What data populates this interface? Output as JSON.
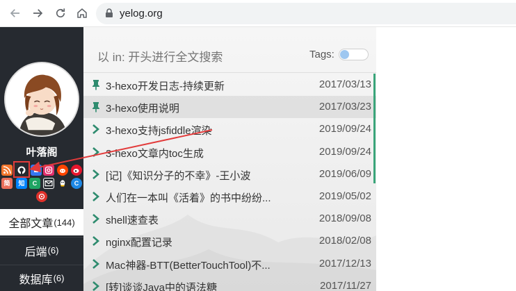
{
  "browser": {
    "url": "yelog.org"
  },
  "sidebar": {
    "site_name": "叶落阁",
    "social_icons": [
      {
        "name": "rss-icon",
        "color": "#f2762c",
        "glyph": "rss"
      },
      {
        "name": "github-icon",
        "color": "#262a30",
        "glyph": "github"
      },
      {
        "name": "blue-square-icon",
        "color": "#3577f0",
        "glyph": "square"
      },
      {
        "name": "instagram-icon",
        "color": "#e1306c",
        "glyph": "instagram"
      },
      {
        "name": "reddit-icon",
        "color": "#ff4500",
        "glyph": "reddit"
      },
      {
        "name": "weibo-icon",
        "color": "#e6162d",
        "glyph": "weibo"
      },
      {
        "name": "jianshu-icon",
        "color": "#ea6f5a",
        "glyph": "简"
      },
      {
        "name": "zhihu-icon",
        "color": "#0084ff",
        "glyph": "知"
      },
      {
        "name": "csdn-icon",
        "color": "#1fa463",
        "glyph": "C"
      },
      {
        "name": "mail-icon",
        "color": "#262a30",
        "glyph": "mail"
      },
      {
        "name": "qq-icon",
        "color": "#262a30",
        "glyph": "qq"
      },
      {
        "name": "csdn-alt-icon",
        "color": "#1e88e5",
        "glyph": "C"
      },
      {
        "name": "neteasemusic-icon",
        "color": "#e0312b",
        "glyph": "music"
      }
    ],
    "categories": [
      {
        "label": "全部文章",
        "count": "(144)",
        "active": true
      },
      {
        "label": "后端",
        "count": "(6)",
        "active": false
      },
      {
        "label": "数据库",
        "count": "(6)",
        "active": false
      }
    ]
  },
  "search": {
    "placeholder": "以 in: 开头进行全文搜索",
    "tags_label": "Tags:"
  },
  "posts": [
    {
      "title": "3-hexo开发日志-持续更新",
      "date": "2017/03/13",
      "pinned": true
    },
    {
      "title": "3-hexo使用说明",
      "date": "2017/03/23",
      "pinned": true
    },
    {
      "title": "3-hexo支持jsfiddle渲染",
      "date": "2019/09/24",
      "pinned": false
    },
    {
      "title": "3-hexo文章内toc生成",
      "date": "2019/09/24",
      "pinned": false
    },
    {
      "title": "[记]《知识分子的不幸》-王小波",
      "date": "2019/06/09",
      "pinned": false
    },
    {
      "title": "人们在一本叫《活着》的书中纷纷...",
      "date": "2019/05/02",
      "pinned": false
    },
    {
      "title": "shell速查表",
      "date": "2018/09/08",
      "pinned": false
    },
    {
      "title": "nginx配置记录",
      "date": "2018/02/08",
      "pinned": false
    },
    {
      "title": "Mac神器-BTT(BetterTouchTool)不...",
      "date": "2017/12/13",
      "pinned": false
    },
    {
      "title": "[转]谈谈Java中的语法糖",
      "date": "2017/11/27",
      "pinned": false
    }
  ],
  "colors": {
    "accent": "#2e8b6e",
    "sidebar_bg": "#262a30",
    "annotation": "#e23b3b"
  }
}
